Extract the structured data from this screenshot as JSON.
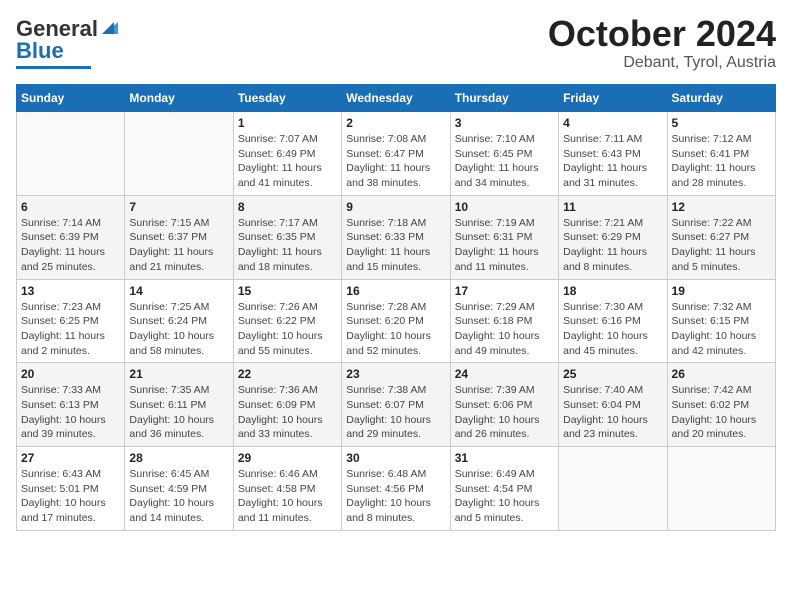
{
  "header": {
    "logo_line1": "General",
    "logo_line2": "Blue",
    "month": "October 2024",
    "location": "Debant, Tyrol, Austria"
  },
  "weekdays": [
    "Sunday",
    "Monday",
    "Tuesday",
    "Wednesday",
    "Thursday",
    "Friday",
    "Saturday"
  ],
  "weeks": [
    [
      {
        "day": "",
        "info": ""
      },
      {
        "day": "",
        "info": ""
      },
      {
        "day": "1",
        "info": "Sunrise: 7:07 AM\nSunset: 6:49 PM\nDaylight: 11 hours and 41 minutes."
      },
      {
        "day": "2",
        "info": "Sunrise: 7:08 AM\nSunset: 6:47 PM\nDaylight: 11 hours and 38 minutes."
      },
      {
        "day": "3",
        "info": "Sunrise: 7:10 AM\nSunset: 6:45 PM\nDaylight: 11 hours and 34 minutes."
      },
      {
        "day": "4",
        "info": "Sunrise: 7:11 AM\nSunset: 6:43 PM\nDaylight: 11 hours and 31 minutes."
      },
      {
        "day": "5",
        "info": "Sunrise: 7:12 AM\nSunset: 6:41 PM\nDaylight: 11 hours and 28 minutes."
      }
    ],
    [
      {
        "day": "6",
        "info": "Sunrise: 7:14 AM\nSunset: 6:39 PM\nDaylight: 11 hours and 25 minutes."
      },
      {
        "day": "7",
        "info": "Sunrise: 7:15 AM\nSunset: 6:37 PM\nDaylight: 11 hours and 21 minutes."
      },
      {
        "day": "8",
        "info": "Sunrise: 7:17 AM\nSunset: 6:35 PM\nDaylight: 11 hours and 18 minutes."
      },
      {
        "day": "9",
        "info": "Sunrise: 7:18 AM\nSunset: 6:33 PM\nDaylight: 11 hours and 15 minutes."
      },
      {
        "day": "10",
        "info": "Sunrise: 7:19 AM\nSunset: 6:31 PM\nDaylight: 11 hours and 11 minutes."
      },
      {
        "day": "11",
        "info": "Sunrise: 7:21 AM\nSunset: 6:29 PM\nDaylight: 11 hours and 8 minutes."
      },
      {
        "day": "12",
        "info": "Sunrise: 7:22 AM\nSunset: 6:27 PM\nDaylight: 11 hours and 5 minutes."
      }
    ],
    [
      {
        "day": "13",
        "info": "Sunrise: 7:23 AM\nSunset: 6:25 PM\nDaylight: 11 hours and 2 minutes."
      },
      {
        "day": "14",
        "info": "Sunrise: 7:25 AM\nSunset: 6:24 PM\nDaylight: 10 hours and 58 minutes."
      },
      {
        "day": "15",
        "info": "Sunrise: 7:26 AM\nSunset: 6:22 PM\nDaylight: 10 hours and 55 minutes."
      },
      {
        "day": "16",
        "info": "Sunrise: 7:28 AM\nSunset: 6:20 PM\nDaylight: 10 hours and 52 minutes."
      },
      {
        "day": "17",
        "info": "Sunrise: 7:29 AM\nSunset: 6:18 PM\nDaylight: 10 hours and 49 minutes."
      },
      {
        "day": "18",
        "info": "Sunrise: 7:30 AM\nSunset: 6:16 PM\nDaylight: 10 hours and 45 minutes."
      },
      {
        "day": "19",
        "info": "Sunrise: 7:32 AM\nSunset: 6:15 PM\nDaylight: 10 hours and 42 minutes."
      }
    ],
    [
      {
        "day": "20",
        "info": "Sunrise: 7:33 AM\nSunset: 6:13 PM\nDaylight: 10 hours and 39 minutes."
      },
      {
        "day": "21",
        "info": "Sunrise: 7:35 AM\nSunset: 6:11 PM\nDaylight: 10 hours and 36 minutes."
      },
      {
        "day": "22",
        "info": "Sunrise: 7:36 AM\nSunset: 6:09 PM\nDaylight: 10 hours and 33 minutes."
      },
      {
        "day": "23",
        "info": "Sunrise: 7:38 AM\nSunset: 6:07 PM\nDaylight: 10 hours and 29 minutes."
      },
      {
        "day": "24",
        "info": "Sunrise: 7:39 AM\nSunset: 6:06 PM\nDaylight: 10 hours and 26 minutes."
      },
      {
        "day": "25",
        "info": "Sunrise: 7:40 AM\nSunset: 6:04 PM\nDaylight: 10 hours and 23 minutes."
      },
      {
        "day": "26",
        "info": "Sunrise: 7:42 AM\nSunset: 6:02 PM\nDaylight: 10 hours and 20 minutes."
      }
    ],
    [
      {
        "day": "27",
        "info": "Sunrise: 6:43 AM\nSunset: 5:01 PM\nDaylight: 10 hours and 17 minutes."
      },
      {
        "day": "28",
        "info": "Sunrise: 6:45 AM\nSunset: 4:59 PM\nDaylight: 10 hours and 14 minutes."
      },
      {
        "day": "29",
        "info": "Sunrise: 6:46 AM\nSunset: 4:58 PM\nDaylight: 10 hours and 11 minutes."
      },
      {
        "day": "30",
        "info": "Sunrise: 6:48 AM\nSunset: 4:56 PM\nDaylight: 10 hours and 8 minutes."
      },
      {
        "day": "31",
        "info": "Sunrise: 6:49 AM\nSunset: 4:54 PM\nDaylight: 10 hours and 5 minutes."
      },
      {
        "day": "",
        "info": ""
      },
      {
        "day": "",
        "info": ""
      }
    ]
  ]
}
